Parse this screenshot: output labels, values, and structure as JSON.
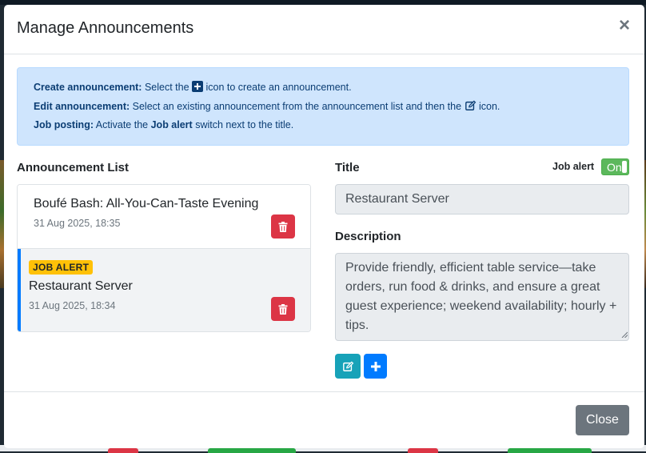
{
  "modal": {
    "title": "Manage Announcements",
    "close_symbol": "×"
  },
  "info": {
    "line1_bold": "Create announcement:",
    "line1_pre": "Select the",
    "line1_post": "icon to create an announcement.",
    "line2_bold": "Edit announcement:",
    "line2_pre": "Select an existing announcement from the announcement list and then the",
    "line2_post": "icon.",
    "line3_bold": "Job posting:",
    "line3_pre": "Activate the",
    "line3_mid_bold": "Job alert",
    "line3_post": "switch next to the title.",
    "icons": [
      "plus-square-icon",
      "edit-icon"
    ]
  },
  "list": {
    "heading": "Announcement List",
    "items": [
      {
        "title": "Boufé Bash: All-You-Can-Taste Evening",
        "date": "31 Aug 2025, 18:35",
        "badge": "",
        "selected": false,
        "icon": "trash-icon"
      },
      {
        "title": "Restaurant Server",
        "date": "31 Aug 2025, 18:34",
        "badge": "JOB ALERT",
        "selected": true,
        "icon": "trash-icon"
      }
    ]
  },
  "form": {
    "title_label": "Title",
    "job_alert_label": "Job alert",
    "toggle_text": "On",
    "title_value": "Restaurant Server",
    "description_label": "Description",
    "description_value": "Provide friendly, efficient table service—take orders, run food & drinks, and ensure a great guest experience; weekend availability; hourly + tips."
  },
  "actions": {
    "edit_icon": "edit-icon",
    "add_icon": "plus-icon"
  },
  "footer": {
    "close_label": "Close"
  },
  "colors": {
    "info_bg": "#cfe5fd",
    "info_text": "#0b3d73",
    "danger": "#dc3545",
    "primary": "#007bff",
    "info_btn": "#17a2b8",
    "badge": "#ffc107",
    "toggle_on": "#5cb85c",
    "secondary": "#6c757d"
  }
}
